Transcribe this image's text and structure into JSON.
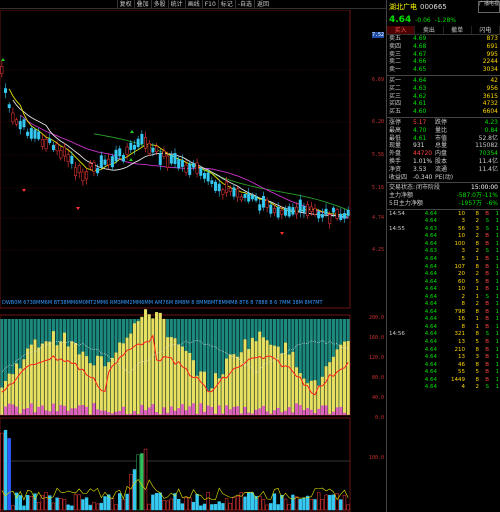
{
  "toolbar": [
    "复权",
    "叠加",
    "多股",
    "统计",
    "画线",
    "F10",
    "标记",
    "-自选",
    "返回"
  ],
  "stock": {
    "name": "湖北广电",
    "code": "000665",
    "badge": "广播电视",
    "price": "4.64",
    "change": "-0.06",
    "pct": "-1.28%"
  },
  "tabs": [
    "买入",
    "卖出",
    "撤单",
    "闪电"
  ],
  "sells": [
    {
      "l": "卖五",
      "p": "4.69",
      "q": "873"
    },
    {
      "l": "卖四",
      "p": "4.68",
      "q": "691"
    },
    {
      "l": "卖三",
      "p": "4.67",
      "q": "995"
    },
    {
      "l": "卖二",
      "p": "4.66",
      "q": "2244"
    },
    {
      "l": "卖一",
      "p": "4.65",
      "q": "3034"
    }
  ],
  "buys": [
    {
      "l": "买一",
      "p": "4.64",
      "q": "42"
    },
    {
      "l": "买二",
      "p": "4.63",
      "q": "956"
    },
    {
      "l": "买三",
      "p": "4.62",
      "q": "3615"
    },
    {
      "l": "买四",
      "p": "4.61",
      "q": "4732"
    },
    {
      "l": "买五",
      "p": "4.60",
      "q": "6604"
    }
  ],
  "info": [
    {
      "a": "涨停",
      "b": "5.17",
      "c": "跌停",
      "d": "4.23"
    },
    {
      "a": "最高",
      "b": "4.70",
      "c": "量比",
      "d": "0.84"
    },
    {
      "a": "最低",
      "b": "4.61",
      "c": "市值",
      "d": "52.8亿"
    },
    {
      "a": "现量",
      "b": "931",
      "c": "总量",
      "d": "115082"
    },
    {
      "a": "外盘",
      "b": "44720",
      "c": "内盘",
      "d": "70354"
    },
    {
      "a": "换手",
      "b": "1.01%",
      "c": "股本",
      "d": "11.4亿"
    },
    {
      "a": "净资",
      "b": "3.53",
      "c": "流通",
      "d": "11.4亿"
    },
    {
      "a": "收益四",
      "b": "-0.340",
      "c": "PE(动)",
      "d": ""
    }
  ],
  "status": {
    "label": "交易状态:",
    "value": "闭市阶段",
    "time": "15:00:00"
  },
  "flow": [
    {
      "l": "主力净额",
      "v": "-587.0万",
      "p": "-11%"
    },
    {
      "l": "5日主力净额",
      "v": "-1957万",
      "p": "-6%"
    }
  ],
  "ticks": [
    {
      "t": "14:54",
      "p": "4.64",
      "v": "10",
      "n": "8",
      "s": "B",
      "x": "1"
    },
    {
      "t": "",
      "p": "4.64",
      "v": "3",
      "n": "2",
      "s": "S",
      "x": "1"
    },
    {
      "t": "14:55",
      "p": "4.63",
      "v": "56",
      "n": "3",
      "s": "S",
      "x": "1"
    },
    {
      "t": "",
      "p": "4.64",
      "v": "10",
      "n": "2",
      "s": "B",
      "x": "1"
    },
    {
      "t": "",
      "p": "4.64",
      "v": "100",
      "n": "8",
      "s": "B",
      "x": "1"
    },
    {
      "t": "",
      "p": "4.63",
      "v": "3",
      "n": "2",
      "s": "S",
      "x": "1"
    },
    {
      "t": "",
      "p": "4.64",
      "v": "5",
      "n": "1",
      "s": "B",
      "x": "1"
    },
    {
      "t": "",
      "p": "4.64",
      "v": "107",
      "n": "8",
      "s": "B",
      "x": "1"
    },
    {
      "t": "",
      "p": "4.64",
      "v": "20",
      "n": "2",
      "s": "B",
      "x": "1"
    },
    {
      "t": "",
      "p": "4.64",
      "v": "60",
      "n": "5",
      "s": "B",
      "x": "1"
    },
    {
      "t": "",
      "p": "4.64",
      "v": "10",
      "n": "1",
      "s": "B",
      "x": "1"
    },
    {
      "t": "",
      "p": "4.64",
      "v": "2",
      "n": "1",
      "s": "S",
      "x": "1"
    },
    {
      "t": "",
      "p": "4.64",
      "v": "8",
      "n": "2",
      "s": "B",
      "x": "1"
    },
    {
      "t": "",
      "p": "4.64",
      "v": "798",
      "n": "8",
      "s": "B",
      "x": "1"
    },
    {
      "t": "",
      "p": "4.64",
      "v": "16",
      "n": "1",
      "s": "B",
      "x": "1"
    },
    {
      "t": "",
      "p": "4.64",
      "v": "8",
      "n": "1",
      "s": "B",
      "x": "1"
    },
    {
      "t": "14:56",
      "p": "4.64",
      "v": "321",
      "n": "8",
      "s": "S",
      "x": "1"
    },
    {
      "t": "",
      "p": "4.64",
      "v": "13",
      "n": "5",
      "s": "B",
      "x": "1"
    },
    {
      "t": "",
      "p": "4.64",
      "v": "210",
      "n": "8",
      "s": "B",
      "x": "1"
    },
    {
      "t": "",
      "p": "4.64",
      "v": "13",
      "n": "3",
      "s": "B",
      "x": "1"
    },
    {
      "t": "",
      "p": "4.64",
      "v": "46",
      "n": "8",
      "s": "B",
      "x": "1"
    },
    {
      "t": "",
      "p": "4.64",
      "v": "55",
      "n": "5",
      "s": "B",
      "x": "1"
    },
    {
      "t": "",
      "p": "4.64",
      "v": "1449",
      "n": "8",
      "s": "B",
      "x": "1"
    },
    {
      "t": "",
      "p": "4.64",
      "v": "4",
      "n": "2",
      "s": "S",
      "x": "1"
    }
  ],
  "yticks": [
    {
      "v": "7.52",
      "top": 35
    },
    {
      "v": "6.69",
      "top": 80
    },
    {
      "v": "6.20",
      "top": 122
    },
    {
      "v": "5.56",
      "top": 155
    },
    {
      "v": "5.16",
      "top": 188
    },
    {
      "v": "4.74",
      "top": 218
    },
    {
      "v": "4.25",
      "top": 250
    }
  ],
  "ind_ticks": [
    {
      "v": "200.0"
    },
    {
      "v": "160.0"
    },
    {
      "v": "120.0"
    },
    {
      "v": "80.0"
    },
    {
      "v": "40.0"
    },
    {
      "v": "0.0"
    },
    {
      "v": "100.0"
    }
  ],
  "legend": "DWB0M  6738MM6M  BT38MM6M0MT2MM6  RM3MM2MM6MM  AM76M 8M8M 8 8MM8MT8MMM8  8T6 8 7888 8 6 7MM 38M 8M7MT"
}
